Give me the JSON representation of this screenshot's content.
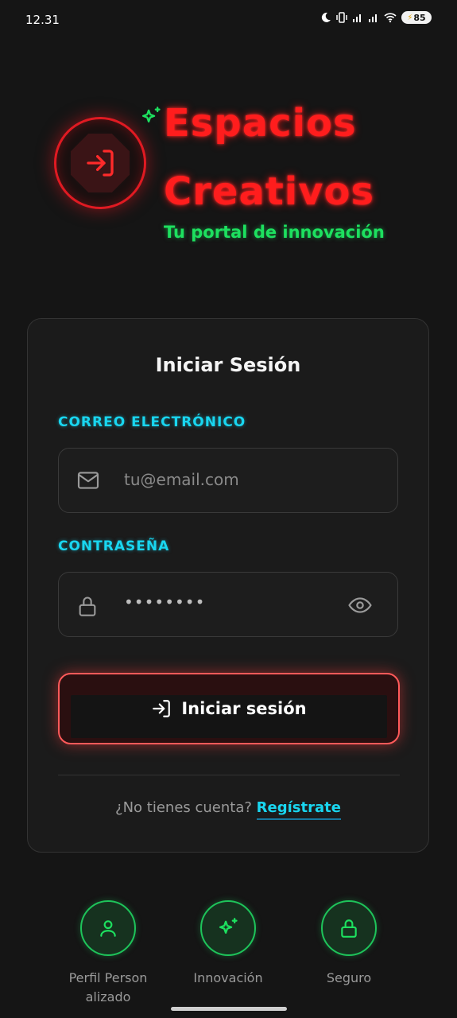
{
  "status_bar": {
    "time": "12.31",
    "battery": "85",
    "icons": [
      "moon-icon",
      "vibrate-icon",
      "signal-icon",
      "signal-icon",
      "wifi-icon",
      "battery-icon"
    ]
  },
  "brand": {
    "title_line1": "Espacios",
    "title_line2": "Creativos",
    "tagline": "Tu portal de innovación",
    "logo_icon": "login-arrow-icon",
    "accent_red": "#ff1d1d",
    "accent_green": "#1de05f"
  },
  "card": {
    "title": "Iniciar Sesión",
    "email": {
      "label": "CORREO ELECTRÓNICO",
      "placeholder": "tu@email.com",
      "icon": "mail-icon"
    },
    "password": {
      "label": "CONTRASEÑA",
      "value": "••••••••",
      "icon": "lock-icon",
      "toggle_icon": "eye-icon"
    },
    "login_button": "Iniciar sesión",
    "signup_prompt": "¿No tienes cuenta?",
    "signup_link": "Regístrate",
    "accent_cyan": "#19d6f0"
  },
  "features": [
    {
      "label": "Perfil Person alizado",
      "icon": "user-icon"
    },
    {
      "label": "Innovación",
      "icon": "sparkle-icon"
    },
    {
      "label": "Seguro",
      "icon": "lock-icon"
    }
  ]
}
